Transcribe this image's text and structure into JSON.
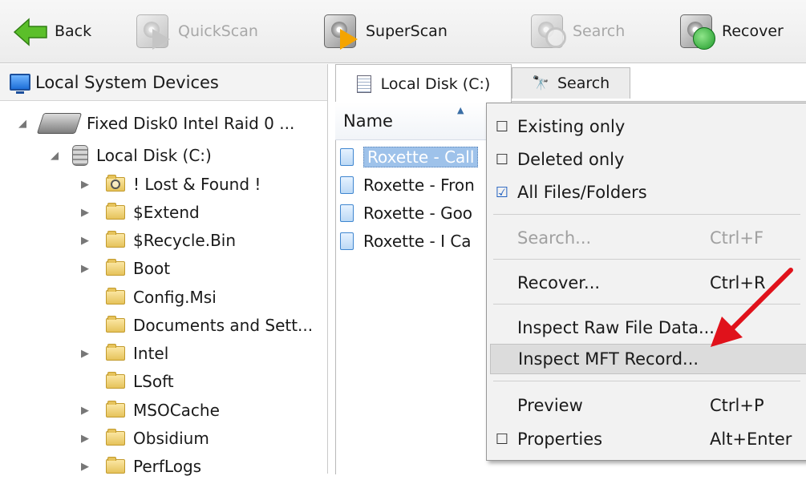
{
  "toolbar": {
    "back_label": "Back",
    "quickscan_label": "QuickScan",
    "superscan_label": "SuperScan",
    "search_label": "Search",
    "recover_label": "Recover"
  },
  "left_panel": {
    "title": "Local System Devices",
    "disk0_label": "Fixed Disk0 Intel   Raid 0 ...",
    "volume_label": "Local Disk (C:)",
    "folders": [
      "! Lost & Found !",
      "$Extend",
      "$Recycle.Bin",
      "Boot",
      "Config.Msi",
      "Documents and Sett...",
      "Intel",
      "LSoft",
      "MSOCache",
      "Obsidium",
      "PerfLogs"
    ]
  },
  "tabs": {
    "local_disk": "Local Disk (C:)",
    "search": "Search"
  },
  "file_list": {
    "column_name": "Name",
    "rows": [
      "Roxette - Call",
      "Roxette - Fron",
      "Roxette - Goo",
      "Roxette - I Ca"
    ]
  },
  "context_menu": {
    "existing_only": "Existing only",
    "deleted_only": "Deleted only",
    "all_files": "All Files/Folders",
    "search": "Search...",
    "search_shortcut": "Ctrl+F",
    "recover": "Recover...",
    "recover_shortcut": "Ctrl+R",
    "inspect_raw": "Inspect Raw File Data...",
    "inspect_mft": "Inspect MFT Record...",
    "preview": "Preview",
    "preview_shortcut": "Ctrl+P",
    "properties": "Properties",
    "properties_shortcut": "Alt+Enter"
  },
  "glyphs": {
    "expanded": "◢",
    "collapsed": "▶",
    "unchecked": "☐",
    "checked": "☑",
    "sort_up": "▲"
  },
  "colors": {
    "selection": "#9ec2ea",
    "menu_hover": "#dcdcdc",
    "annotation_arrow": "#e0121b"
  }
}
